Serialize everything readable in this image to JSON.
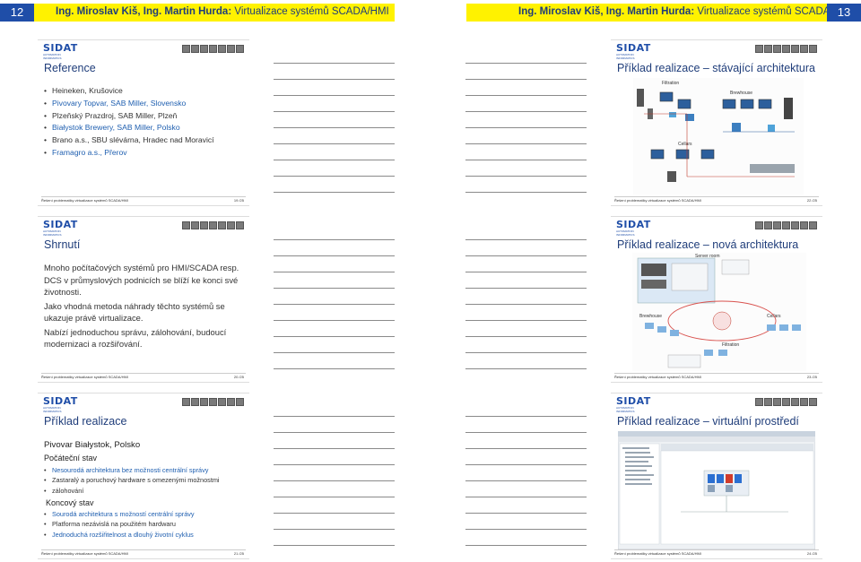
{
  "header": {
    "left_page": "12",
    "right_page": "13",
    "left_authors": "Ing. Miroslav Kiš, Ing. Martin Hurda:",
    "left_title": "Virtualizace systémů SCADA/HMI",
    "right_authors": "Ing. Miroslav Kiš, Ing. Martin Hurda:",
    "right_title": "Virtualizace systémů SCADA/HMI"
  },
  "logo": {
    "main": "SIDAT",
    "sub": "AUTOMATION INFORMATICS"
  },
  "footer_text": "Řešení problematiky virtualizace systémů SCADA/HMI",
  "slides": {
    "reference": {
      "title": "Reference",
      "page": "19 /25",
      "items": [
        {
          "text": "Heineken, Krušovice"
        },
        {
          "text": "Pivovary Topvar, SAB Miller, Slovensko"
        },
        {
          "text": "Plzeňský Prazdroj, SAB Miller, Plzeň"
        },
        {
          "text": "Białystok Brewery, SAB Miller, Polsko"
        },
        {
          "text": "Brano a.s., SBU slévárna, Hradec nad Moravicí"
        },
        {
          "text": "Framagro a.s., Přerov"
        }
      ]
    },
    "shrnuti": {
      "title": "Shrnutí",
      "page": "20 /25",
      "p1": "Mnoho počítačových systémů pro HMI/SCADA resp. DCS v průmyslových podnicích se blíží ke konci své životnosti.",
      "p2": "Jako vhodná metoda náhrady těchto systémů se ukazuje právě virtualizace.",
      "p3": "Nabízí jednoduchou správu, zálohování, budoucí modernizaci a rozšiřování."
    },
    "priklad": {
      "title": "Příklad realizace",
      "page": "21 /25",
      "heading": "Pivovar Białystok, Polsko",
      "initial_label": "Počáteční stav",
      "initial_items": [
        {
          "text": "Nesourodá architektura bez možnosti centrální správy"
        },
        {
          "text": "Zastaralý a poruchový hardware s omezenými možnostmi"
        },
        {
          "text": "zálohování"
        }
      ],
      "final_label": "Koncový stav",
      "final_items": [
        {
          "text": "Sourodá architektura s možností centrální správy"
        },
        {
          "text": "Platforma nezávislá na použitém hardwaru"
        },
        {
          "text": "Jednoduchá rozšiřitelnost a dlouhý životní cyklus"
        }
      ]
    },
    "stavajici": {
      "title": "Příklad realizace – stávající architektura",
      "page": "22 /25",
      "labels": {
        "filtration": "Filtration",
        "brewhouse": "Brewhouse",
        "cellars": "Cellars"
      }
    },
    "nova": {
      "title": "Příklad realizace – nová architektura",
      "page": "23 /25",
      "labels": {
        "server_room": "Server room",
        "brewhouse": "Brewhouse",
        "cellars": "Cellars",
        "filtration": "Filtration"
      }
    },
    "virtualni": {
      "title": "Příklad realizace – virtuální prostředí",
      "page": "24 /25"
    }
  },
  "colors": {
    "header_bg": "#fff200",
    "page_badge": "#1f4ea8",
    "title": "#1f3d7a",
    "bullet_blue": "#1f5fb0"
  }
}
